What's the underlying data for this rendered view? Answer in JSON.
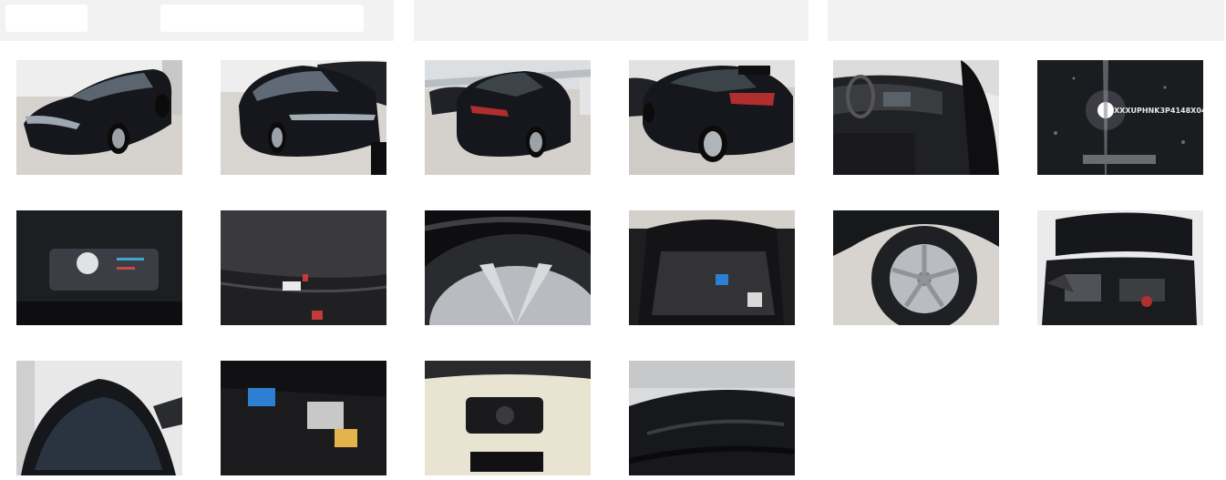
{
  "header": {
    "sections": 3
  },
  "gallery": {
    "photos": [
      {
        "label": "front-left-exterior"
      },
      {
        "label": "front-right-exterior"
      },
      {
        "label": "rear-left-exterior"
      },
      {
        "label": "rear-right-exterior"
      },
      {
        "label": "interior-dashboard"
      },
      {
        "label": "vin-plate",
        "vin_text": "XXXUPHNK3P4148X04"
      },
      {
        "label": "instrument-cluster"
      },
      {
        "label": "rear-seat"
      },
      {
        "label": "tyre-closeup"
      },
      {
        "label": "trunk-open"
      },
      {
        "label": "wheel-rim"
      },
      {
        "label": "engine-bay"
      },
      {
        "label": "windshield"
      },
      {
        "label": "trunk-floor"
      },
      {
        "label": "spare-wheel-well"
      },
      {
        "label": "roof"
      }
    ]
  },
  "colors": {
    "header_bg": "#f2f2f2",
    "car_body": "#15161b",
    "garage_floor": "#d9d4cf"
  }
}
